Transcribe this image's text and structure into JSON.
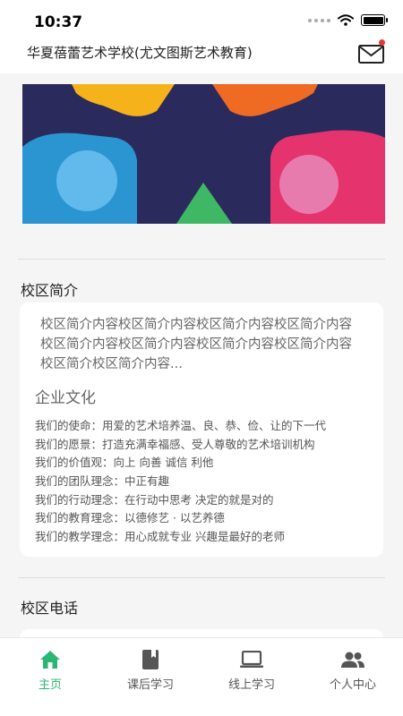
{
  "status_bar": {
    "time": "10:37"
  },
  "header": {
    "title": "华夏蓓蕾艺术学校(尤文图斯艺术教育)"
  },
  "intro": {
    "title": "校区简介",
    "text": "校区简介内容校区简介内容校区简介内容校区简介内容校区简介内容校区简介内容校区简介内容校区简介内容校区简介校区简介内容..."
  },
  "culture": {
    "title": "企业文化",
    "items": [
      "我们的使命：用爱的艺术培养温、良、恭、俭、让的下一代",
      "我们的愿景：打造充满幸福感、受人尊敬的艺术培训机构",
      "我们的价值观：向上 向善 诚信 利他",
      "我们的团队理念：中正有趣",
      "我们的行动理念：在行动中思考  决定的就是对的",
      "我们的教育理念：以德修艺 · 以艺养德",
      "我们的教学理念：用心成就专业  兴趣是最好的老师"
    ]
  },
  "phone": {
    "title": "校区电话"
  },
  "tabs": [
    {
      "label": "主页",
      "icon": "home-icon",
      "active": true
    },
    {
      "label": "课后学习",
      "icon": "book-icon",
      "active": false
    },
    {
      "label": "线上学习",
      "icon": "laptop-icon",
      "active": false
    },
    {
      "label": "个人中心",
      "icon": "people-icon",
      "active": false
    }
  ],
  "colors": {
    "accent": "#2bb673",
    "icon_gray": "#555555",
    "notification": "#e53935"
  }
}
